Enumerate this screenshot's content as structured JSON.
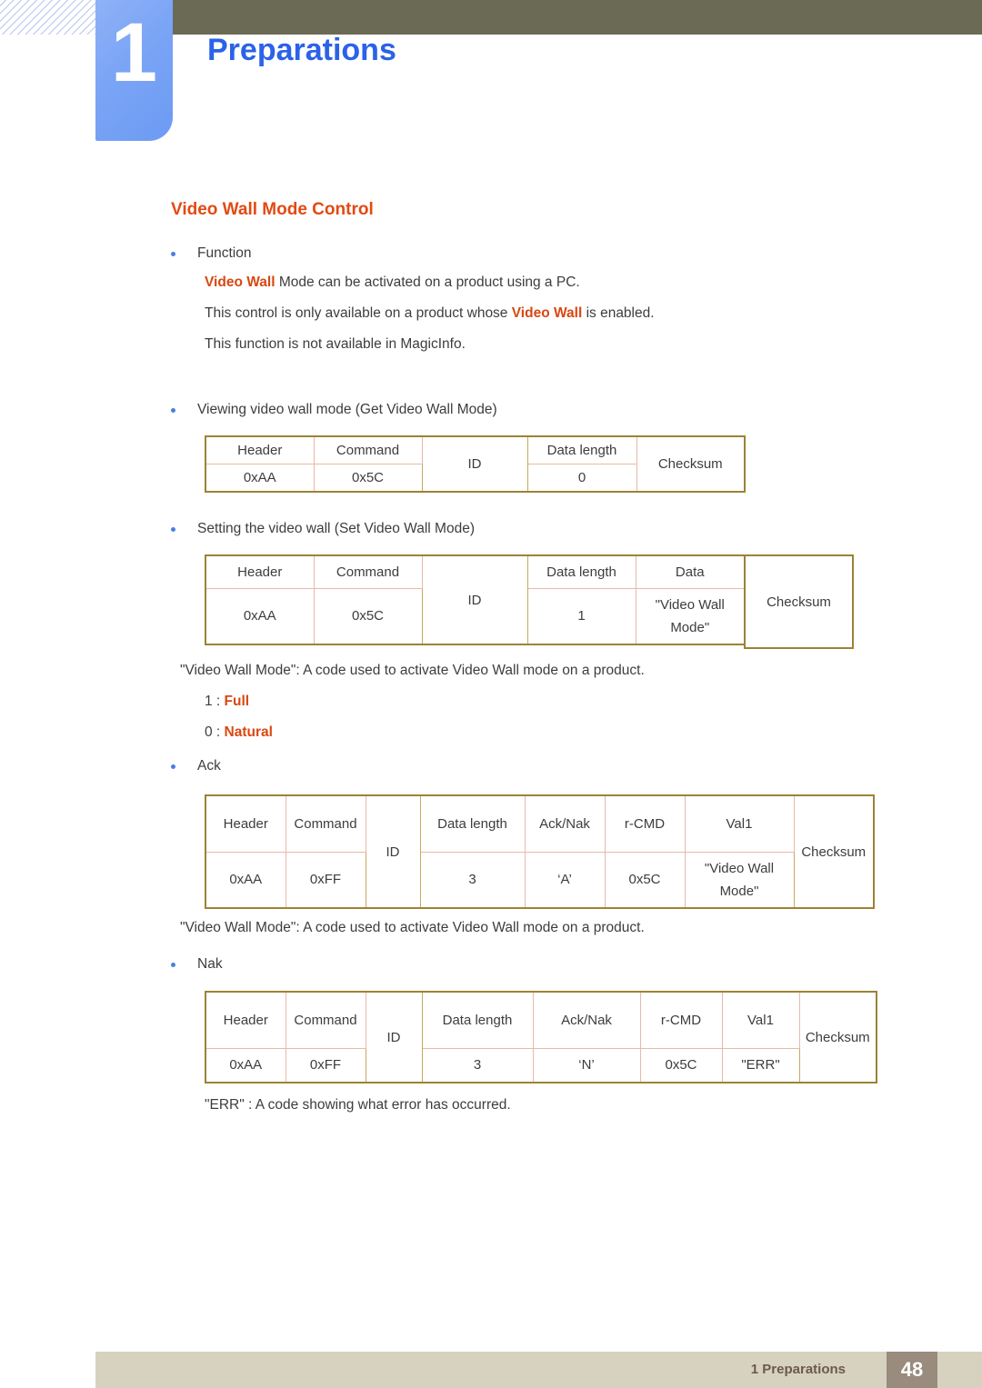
{
  "header": {
    "chapter_number": "1",
    "chapter_title": "Preparations"
  },
  "section": {
    "title": "Video Wall Mode Control"
  },
  "function_block": {
    "bullet_label": "Function",
    "line1_prefix": "",
    "line1_highlight": "Video Wall",
    "line1_rest": " Mode can be activated on a product using a PC.",
    "line2_prefix": "This control is only available on a product whose ",
    "line2_highlight": "Video Wall",
    "line2_rest": " is enabled.",
    "line3": "This function is not available in MagicInfo."
  },
  "get_block": {
    "bullet_label": "Viewing video wall mode (Get Video Wall Mode)",
    "table": {
      "headers": [
        "Header",
        "Command",
        "ID",
        "Data length",
        "Checksum"
      ],
      "values": [
        "0xAA",
        "0x5C",
        "",
        "0",
        ""
      ]
    }
  },
  "set_block": {
    "bullet_label": "Setting the video wall (Set Video Wall Mode)",
    "table": {
      "headers": [
        "Header",
        "Command",
        "ID",
        "Data length",
        "Data",
        "Checksum"
      ],
      "values": [
        "0xAA",
        "0x5C",
        "",
        "1",
        "\"Video Wall Mode\"",
        ""
      ]
    },
    "note": "\"Video Wall Mode\": A code used to activate Video Wall mode on a product.",
    "code1_prefix": "1 : ",
    "code1_value": "Full",
    "code0_prefix": "0 : ",
    "code0_value": "Natural"
  },
  "ack_block": {
    "bullet_label": "Ack",
    "table": {
      "headers": [
        "Header",
        "Command",
        "ID",
        "Data length",
        "Ack/Nak",
        "r-CMD",
        "Val1",
        "Checksum"
      ],
      "values": [
        "0xAA",
        "0xFF",
        "",
        "3",
        "‘A’",
        "0x5C",
        "\"Video Wall Mode\"",
        ""
      ]
    },
    "note": "\"Video Wall Mode\": A code used to activate Video Wall mode on a product."
  },
  "nak_block": {
    "bullet_label": "Nak",
    "table": {
      "headers": [
        "Header",
        "Command",
        "ID",
        "Data length",
        "Ack/Nak",
        "r-CMD",
        "Val1",
        "Checksum"
      ],
      "values": [
        "0xAA",
        "0xFF",
        "",
        "3",
        "‘N’",
        "0x5C",
        "\"ERR\"",
        ""
      ]
    },
    "note": "\"ERR\" : A code showing what error has occurred."
  },
  "footer": {
    "label": "1 Preparations",
    "page_number": "48"
  },
  "colors": {
    "accent_orange": "#d94712",
    "title_blue": "#2b62e8",
    "badge_blue": "#7aa4f5",
    "olive_bar": "#6b6a54",
    "table_border_outer": "#9c8334",
    "table_border_inner": "#e8b9a8",
    "footer_band": "#d7d2bf",
    "footer_page_box": "#998b7d"
  }
}
